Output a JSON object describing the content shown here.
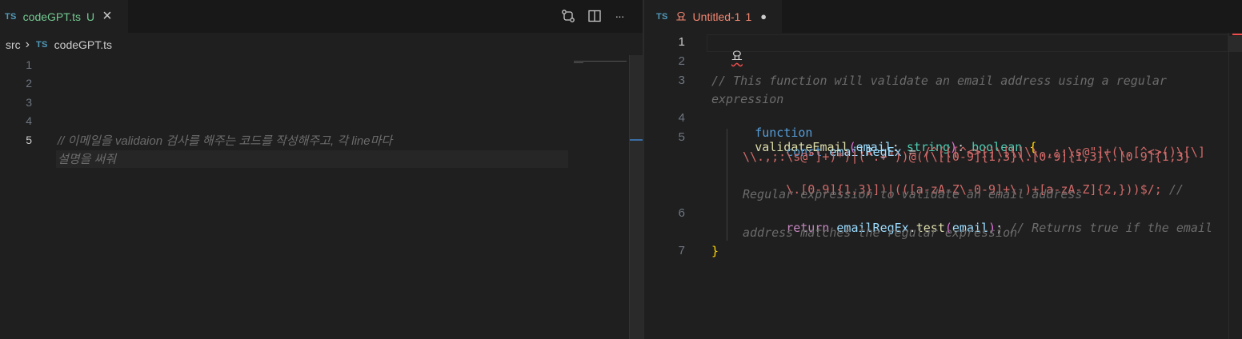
{
  "left": {
    "tab": {
      "badge": "TS",
      "filename": "codeGPT.ts",
      "status": "U",
      "close": "×"
    },
    "toolbar": {
      "compare_icon": "⇄",
      "split_icon": "▯",
      "more": "···"
    },
    "breadcrumb": {
      "folder": "src",
      "sep": "›",
      "badge": "TS",
      "file": "codeGPT.ts"
    },
    "line_numbers": [
      "1",
      "2",
      "3",
      "4",
      "5"
    ],
    "comment_line_1": "// 이메일을 validaion 검사를 해주는 코드를 작성해주고, 각 line마다",
    "comment_line_2": "설명을 써줘"
  },
  "right": {
    "tab": {
      "badge": "TS",
      "icon": "요",
      "filename": "Untitled-1",
      "count": "1",
      "dirty": "●"
    },
    "line_numbers": [
      "1",
      "2",
      "3",
      "4",
      "5",
      "6",
      "7"
    ],
    "line1": "요",
    "line3a": "// This function will validate an email address using a regular",
    "line3b": "expression",
    "line4": {
      "kw": "function",
      "fn": "validateEmail",
      "p1": "(",
      "param": "email",
      "colon": ": ",
      "type1": "string",
      "p2": ")",
      "colon2": ": ",
      "type2": "boolean",
      "brace": " {"
    },
    "line5a_pre": "const ",
    "line5a_var": "emailRegEx",
    "line5a_eq": " = ",
    "line5a_rx": "/^(([^<>()\\[\\]\\\\.,;:\\s@\"]+(\\.[^<>()\\[\\]",
    "line5b_rx": "\\\\.,;:\\s@\"]+)*)|(\".+\"))@((\\[[0-9]{1,3}\\.[0-9]{1,3}\\.[0-9]{1,3}",
    "line5c_rx": "\\.[0-9]{1,3}])|(([a-zA-Z\\-0-9]+\\.)+[a-zA-Z]{2,}))$/;",
    "line5c_cmt": " //",
    "line5d_cmt": "Regular expression to validate an email address",
    "line6": {
      "kw": "return ",
      "var": "emailRegEx",
      "dot": ".",
      "fn": "test",
      "p1": "(",
      "arg": "email",
      "p2": ")",
      "semi": ";",
      "cmt": " // Returns true if the email"
    },
    "line6b_cmt": "address matches the regular expression",
    "line7": "}"
  }
}
